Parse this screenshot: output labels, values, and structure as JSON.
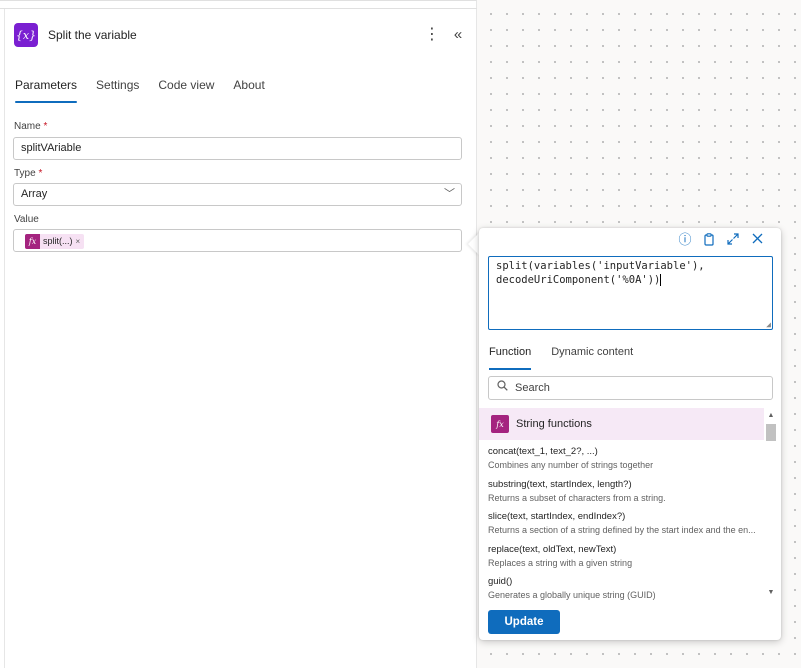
{
  "panel": {
    "icon_text": "{x}",
    "title": "Split the variable",
    "more_glyph": "⋮",
    "collapse_glyph": "«",
    "tabs": [
      {
        "label": "Parameters"
      },
      {
        "label": "Settings"
      },
      {
        "label": "Code view"
      },
      {
        "label": "About"
      }
    ],
    "fields": {
      "name": {
        "label": "Name",
        "required": "*",
        "value": "splitVAriable"
      },
      "type": {
        "label": "Type",
        "required": "*",
        "value": "Array"
      },
      "value": {
        "label": "Value",
        "token_icon": "fx",
        "token_text": "split(...)",
        "token_close": "×"
      }
    }
  },
  "expression_editor": {
    "line1": "split(variables('inputVariable'),",
    "line2": "decodeUriComponent('%0A'))",
    "icons": [
      "info-icon",
      "clipboard-icon",
      "expand-icon",
      "close-icon"
    ],
    "tabs": [
      {
        "label": "Function"
      },
      {
        "label": "Dynamic content"
      }
    ],
    "search_placeholder": "Search",
    "category": {
      "icon": "fx",
      "label": "String functions"
    },
    "functions": [
      {
        "signature": "concat(text_1, text_2?, ...)",
        "description": "Combines any number of strings together"
      },
      {
        "signature": "substring(text, startIndex, length?)",
        "description": "Returns a subset of characters from a string."
      },
      {
        "signature": "slice(text, startIndex, endIndex?)",
        "description": "Returns a section of a string defined by the start index and the en..."
      },
      {
        "signature": "replace(text, oldText, newText)",
        "description": "Replaces a string with a given string"
      },
      {
        "signature": "guid()",
        "description": "Generates a globally unique string (GUID)"
      }
    ],
    "update_label": "Update"
  },
  "colors": {
    "accent": "#0f6cbd",
    "variable_icon": "#7a1fd1",
    "function_icon": "#a4237f",
    "category_bg": "#f6e9f6"
  }
}
